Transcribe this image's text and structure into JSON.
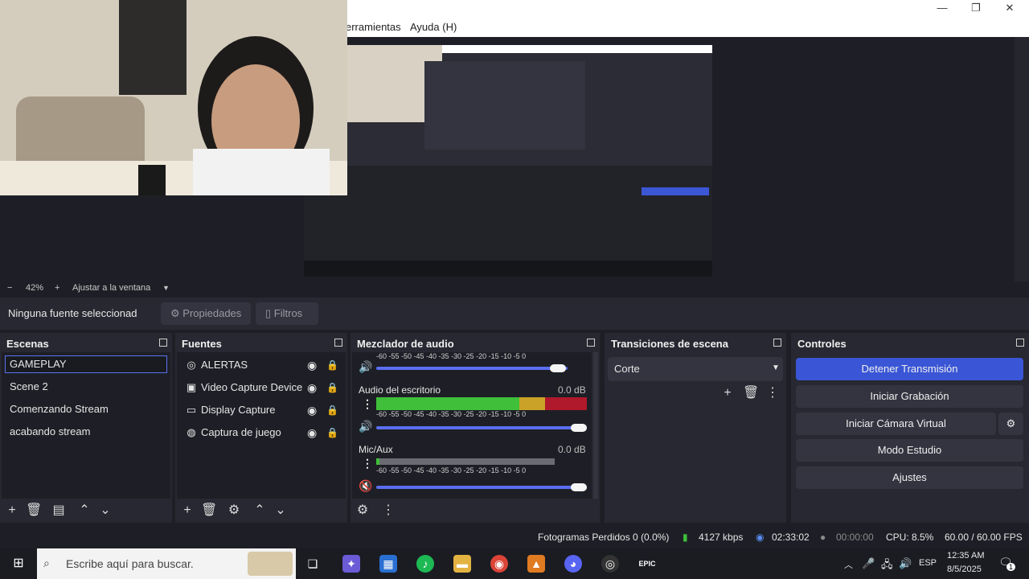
{
  "window": {
    "controls": {
      "minimize": "—",
      "restore": "❐",
      "close": "✕"
    }
  },
  "menu": {
    "items": [
      "erramientas",
      "Ayuda (H)"
    ]
  },
  "preview": {
    "zoom_minus": "−",
    "zoom_value": "42%",
    "zoom_plus": "+",
    "fit_label": "Ajustar a la ventana"
  },
  "source_bar": {
    "no_source": "Ninguna fuente seleccionad",
    "properties": "Propiedades",
    "filters": "Filtros"
  },
  "scenes": {
    "title": "Escenas",
    "items": [
      "GAMEPLAY",
      "Scene 2",
      "Comenzando Stream",
      "acabando stream"
    ],
    "selected_index": 0
  },
  "sources": {
    "title": "Fuentes",
    "items": [
      {
        "label": "ALERTAS",
        "icon": "globe-icon"
      },
      {
        "label": "Video Capture Device",
        "icon": "camera-icon"
      },
      {
        "label": "Display Capture",
        "icon": "monitor-icon"
      },
      {
        "label": "Captura de juego",
        "icon": "gamepad-icon"
      }
    ]
  },
  "mixer": {
    "title": "Mezclador de audio",
    "ticks": "-60  -55  -50  -45  -40  -35  -30  -25  -20  -15  -10   -5    0",
    "channels": [
      {
        "name": "",
        "db": "",
        "level": 0.0,
        "volume": 0.94
      },
      {
        "name": "Audio del escritorio",
        "db": "0.0 dB",
        "level": 1.0,
        "volume": 1.0
      },
      {
        "name": "Mic/Aux",
        "db": "0.0 dB",
        "level": 0.02,
        "volume": 1.0,
        "muted": true
      }
    ]
  },
  "transitions": {
    "title": "Transiciones de escena",
    "selected": "Corte"
  },
  "controls": {
    "title": "Controles",
    "stop_stream": "Detener Transmisión",
    "start_recording": "Iniciar Grabación",
    "start_virtual_cam": "Iniciar Cámara Virtual",
    "studio_mode": "Modo Estudio",
    "settings": "Ajustes"
  },
  "status": {
    "dropped_frames": "Fotogramas Perdidos 0 (0.0%)",
    "bitrate": "4127 kbps",
    "stream_time": "02:33:02",
    "rec_time": "00:00:00",
    "cpu": "CPU: 8.5%",
    "fps": "60.00 / 60.00 FPS"
  },
  "taskbar": {
    "search_placeholder": "Escribe aquí para buscar.",
    "lang": "ESP",
    "time": "12:35 AM",
    "date": "8/5/2025",
    "notifications": "1"
  },
  "colors": {
    "accent": "#3a56d6",
    "meter_green": "#3fbf3a",
    "meter_yellow": "#c9a227",
    "meter_red": "#b0182b"
  }
}
